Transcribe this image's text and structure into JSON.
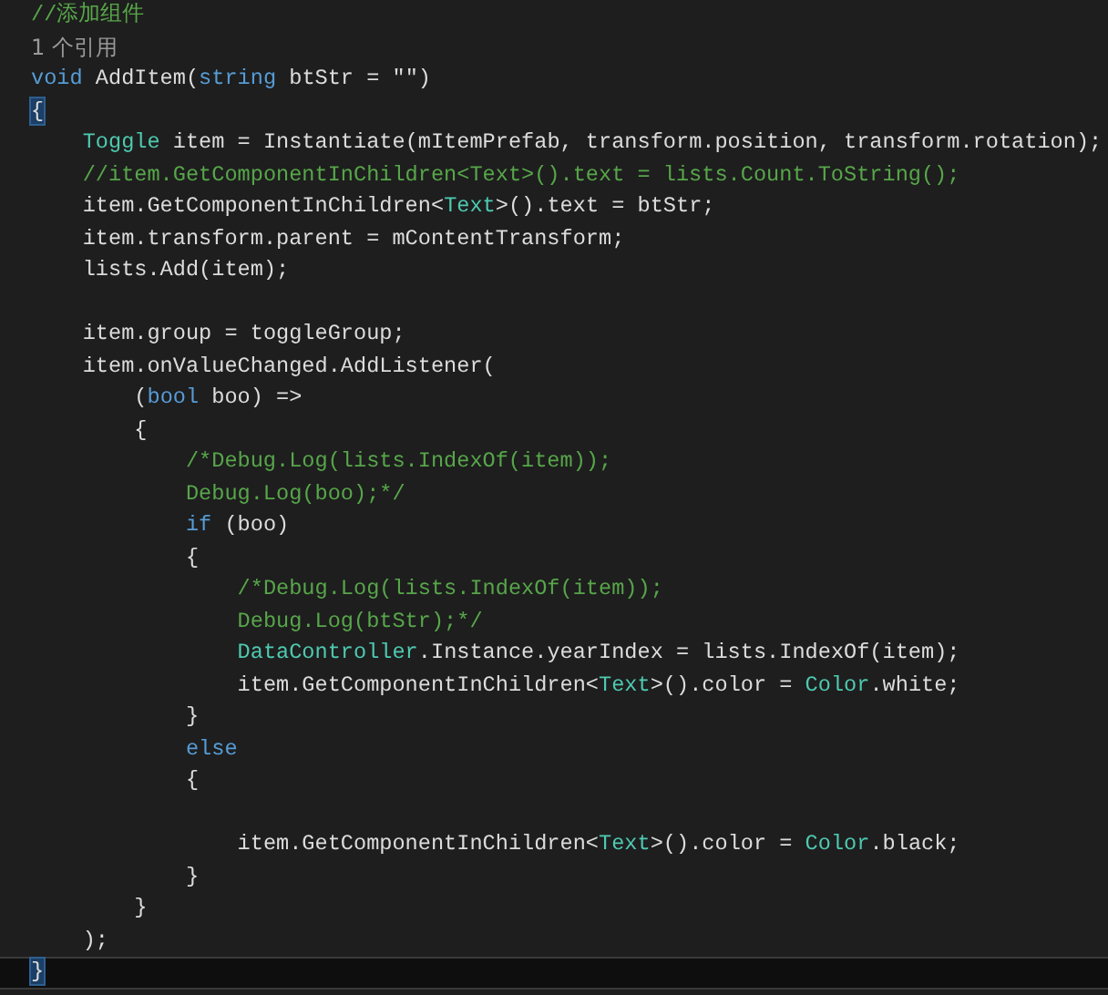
{
  "editor": {
    "lines": [
      {
        "kind": "code",
        "current": false,
        "tokens": [
          {
            "kind": "comment",
            "text": "//添加组件"
          }
        ]
      },
      {
        "kind": "code",
        "current": false,
        "tokens": [
          {
            "kind": "codelens",
            "text": "1 个引用"
          }
        ]
      },
      {
        "kind": "code",
        "current": false,
        "tokens": [
          {
            "kind": "keyword",
            "text": "void"
          },
          {
            "kind": "plain",
            "text": " AddItem("
          },
          {
            "kind": "keyword",
            "text": "string"
          },
          {
            "kind": "plain",
            "text": " btStr = \"\")"
          }
        ]
      },
      {
        "kind": "code",
        "current": false,
        "tokens": [
          {
            "kind": "brace",
            "text": "{"
          }
        ]
      },
      {
        "kind": "code",
        "current": false,
        "tokens": [
          {
            "kind": "type",
            "text": "    Toggle"
          },
          {
            "kind": "plain",
            "text": " item = Instantiate(mItemPrefab, transform.position, transform.rotation);"
          }
        ]
      },
      {
        "kind": "code",
        "current": false,
        "tokens": [
          {
            "kind": "comment",
            "text": "    //item.GetComponentInChildren<Text>().text = lists.Count.ToString();"
          }
        ]
      },
      {
        "kind": "code",
        "current": false,
        "tokens": [
          {
            "kind": "plain",
            "text": "    item.GetComponentInChildren<"
          },
          {
            "kind": "type",
            "text": "Text"
          },
          {
            "kind": "plain",
            "text": ">().text = btStr;"
          }
        ]
      },
      {
        "kind": "code",
        "current": false,
        "tokens": [
          {
            "kind": "plain",
            "text": "    item.transform.parent = mContentTransform;"
          }
        ]
      },
      {
        "kind": "code",
        "current": false,
        "tokens": [
          {
            "kind": "plain",
            "text": "    lists.Add(item);"
          }
        ]
      },
      {
        "kind": "blank",
        "current": false
      },
      {
        "kind": "code",
        "current": false,
        "tokens": [
          {
            "kind": "plain",
            "text": "    item.group = toggleGroup;"
          }
        ]
      },
      {
        "kind": "code",
        "current": false,
        "tokens": [
          {
            "kind": "plain",
            "text": "    item.onValueChanged.AddListener("
          }
        ]
      },
      {
        "kind": "code",
        "current": false,
        "tokens": [
          {
            "kind": "plain",
            "text": "        ("
          },
          {
            "kind": "keyword",
            "text": "bool"
          },
          {
            "kind": "plain",
            "text": " boo) =>"
          }
        ]
      },
      {
        "kind": "code",
        "current": false,
        "tokens": [
          {
            "kind": "plain",
            "text": "        {"
          }
        ]
      },
      {
        "kind": "code",
        "current": false,
        "tokens": [
          {
            "kind": "comment",
            "text": "            /*Debug.Log(lists.IndexOf(item));"
          }
        ]
      },
      {
        "kind": "code",
        "current": false,
        "tokens": [
          {
            "kind": "comment",
            "text": "            Debug.Log(boo);*/"
          }
        ]
      },
      {
        "kind": "code",
        "current": false,
        "tokens": [
          {
            "kind": "keyword",
            "text": "            if"
          },
          {
            "kind": "plain",
            "text": " (boo)"
          }
        ]
      },
      {
        "kind": "code",
        "current": false,
        "tokens": [
          {
            "kind": "plain",
            "text": "            {"
          }
        ]
      },
      {
        "kind": "code",
        "current": false,
        "tokens": [
          {
            "kind": "comment",
            "text": "                /*Debug.Log(lists.IndexOf(item));"
          }
        ]
      },
      {
        "kind": "code",
        "current": false,
        "tokens": [
          {
            "kind": "comment",
            "text": "                Debug.Log(btStr);*/"
          }
        ]
      },
      {
        "kind": "code",
        "current": false,
        "tokens": [
          {
            "kind": "type",
            "text": "                DataController"
          },
          {
            "kind": "plain",
            "text": ".Instance.yearIndex = lists.IndexOf(item);"
          }
        ]
      },
      {
        "kind": "code",
        "current": false,
        "tokens": [
          {
            "kind": "plain",
            "text": "                item.GetComponentInChildren<"
          },
          {
            "kind": "type",
            "text": "Text"
          },
          {
            "kind": "plain",
            "text": ">().color = "
          },
          {
            "kind": "type",
            "text": "Color"
          },
          {
            "kind": "plain",
            "text": ".white;"
          }
        ]
      },
      {
        "kind": "code",
        "current": false,
        "tokens": [
          {
            "kind": "plain",
            "text": "            }"
          }
        ]
      },
      {
        "kind": "code",
        "current": false,
        "tokens": [
          {
            "kind": "keyword",
            "text": "            else"
          }
        ]
      },
      {
        "kind": "code",
        "current": false,
        "tokens": [
          {
            "kind": "plain",
            "text": "            {"
          }
        ]
      },
      {
        "kind": "blank",
        "current": false
      },
      {
        "kind": "code",
        "current": false,
        "tokens": [
          {
            "kind": "plain",
            "text": "                item.GetComponentInChildren<"
          },
          {
            "kind": "type",
            "text": "Text"
          },
          {
            "kind": "plain",
            "text": ">().color = "
          },
          {
            "kind": "type",
            "text": "Color"
          },
          {
            "kind": "plain",
            "text": ".black;"
          }
        ]
      },
      {
        "kind": "code",
        "current": false,
        "tokens": [
          {
            "kind": "plain",
            "text": "            }"
          }
        ]
      },
      {
        "kind": "code",
        "current": false,
        "tokens": [
          {
            "kind": "plain",
            "text": "        }"
          }
        ]
      },
      {
        "kind": "code",
        "current": false,
        "tokens": [
          {
            "kind": "plain",
            "text": "    );"
          }
        ]
      },
      {
        "kind": "code",
        "current": true,
        "tokens": [
          {
            "kind": "brace",
            "text": "}"
          }
        ]
      }
    ]
  }
}
